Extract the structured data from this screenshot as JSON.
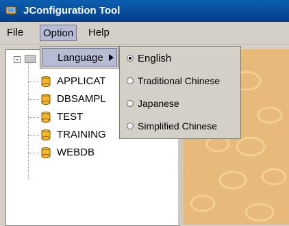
{
  "window": {
    "title": "JConfiguration Tool"
  },
  "menubar": {
    "items": [
      {
        "label": "File",
        "mnemonic": "F"
      },
      {
        "label": "Option",
        "mnemonic": "O"
      },
      {
        "label": "Help",
        "mnemonic": "H"
      }
    ]
  },
  "option_menu": {
    "items": [
      {
        "label": "Language",
        "mnemonic": "L"
      }
    ]
  },
  "language_menu": {
    "items": [
      {
        "label": "English",
        "checked": true
      },
      {
        "label": "Traditional Chinese",
        "checked": false
      },
      {
        "label": "Japanese",
        "checked": false
      },
      {
        "label": "Simplified Chinese",
        "checked": false
      }
    ]
  },
  "tree": {
    "children": [
      "APPLICAT",
      "DBSAMPL",
      "TEST",
      "TRAINING",
      "WEBDB"
    ]
  },
  "colors": {
    "titlebar": "#0b5fb0",
    "menu_bg": "#d4d0c8",
    "menu_highlight": "#b6bcd3",
    "right_panel": "#e7b97a",
    "db_icon": "#f2b72d"
  },
  "icons": {
    "app": "app-icon",
    "collapse": "tree-collapse-icon",
    "root": "server-icon",
    "db": "database-icon",
    "submenu": "chevron-right-icon"
  }
}
